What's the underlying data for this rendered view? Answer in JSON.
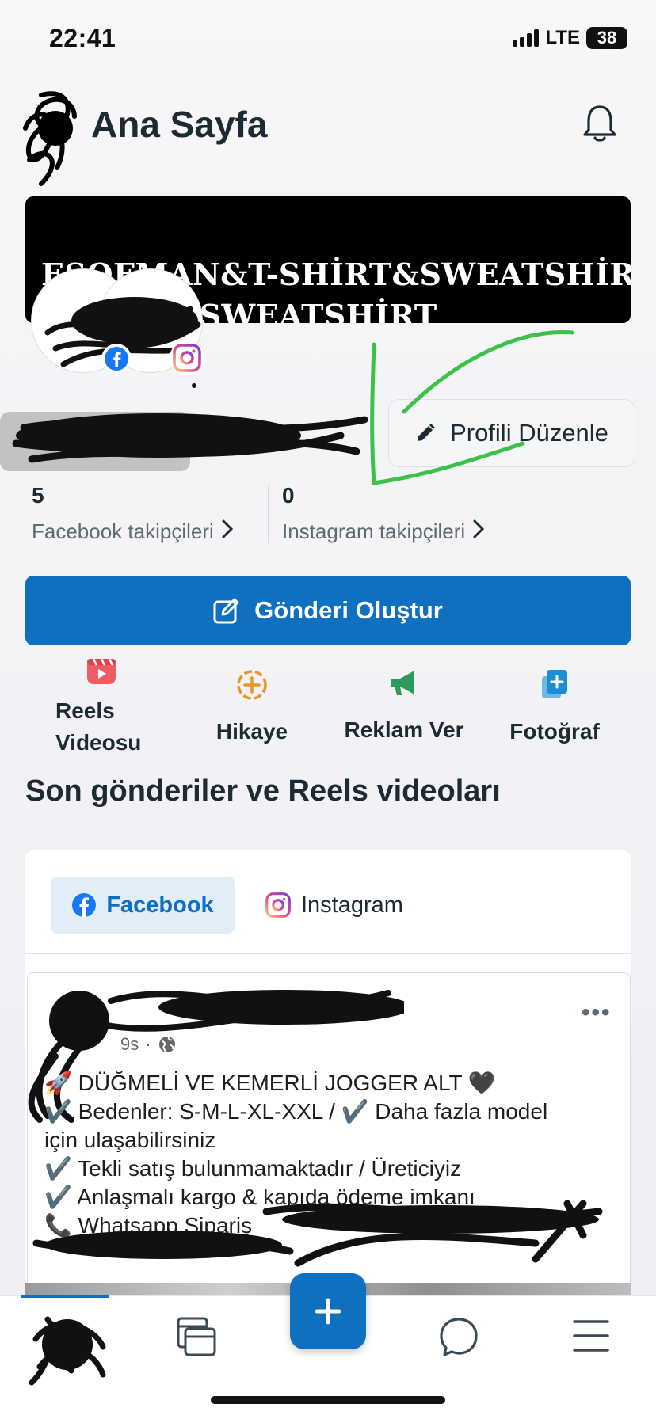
{
  "status_bar": {
    "time": "22:41",
    "network": "LTE",
    "battery": "38"
  },
  "header": {
    "title": "Ana Sayfa"
  },
  "cover": {
    "line1": "EŞOFMAN&T-SHİRT&SWEATSHİRT",
    "line2": "TAKIM &SWEATSHİRT"
  },
  "profile": {
    "edit_label": "Profili Düzenle"
  },
  "stats": {
    "facebook": {
      "count": "5",
      "label": "Facebook takipçileri"
    },
    "instagram": {
      "count": "0",
      "label": "Instagram takipçileri"
    }
  },
  "create_post": {
    "label": "Gönderi Oluştur"
  },
  "actions": [
    {
      "label": "Reels Videosu",
      "icon": "reels-icon"
    },
    {
      "label": "Hikaye",
      "icon": "story-add-icon"
    },
    {
      "label": "Reklam Ver",
      "icon": "megaphone-icon"
    },
    {
      "label": "Fotoğraf",
      "icon": "photo-add-icon"
    }
  ],
  "section": {
    "title": "Son gönderiler ve Reels videoları"
  },
  "tabs": {
    "facebook": "Facebook",
    "instagram": "Instagram"
  },
  "post": {
    "time": "9s",
    "lines": [
      "🚀 DÜĞMELİ VE KEMERLİ JOGGER ALT  🖤",
      "✔️ Bedenler: S-M-L-XL-XXL / ✔️ Daha fazla model",
      "için ulaşabilirsiniz",
      "✔️ Tekli satış bulunmamaktadır / Üreticiyiz",
      "✔️ Anlaşmalı kargo & kapıda ödeme imkanı",
      "📞 Whatsapp Sipariş"
    ]
  },
  "colors": {
    "accent": "#0f6fc1",
    "text": "#1c2b33",
    "annotation": "#3cc24a"
  }
}
